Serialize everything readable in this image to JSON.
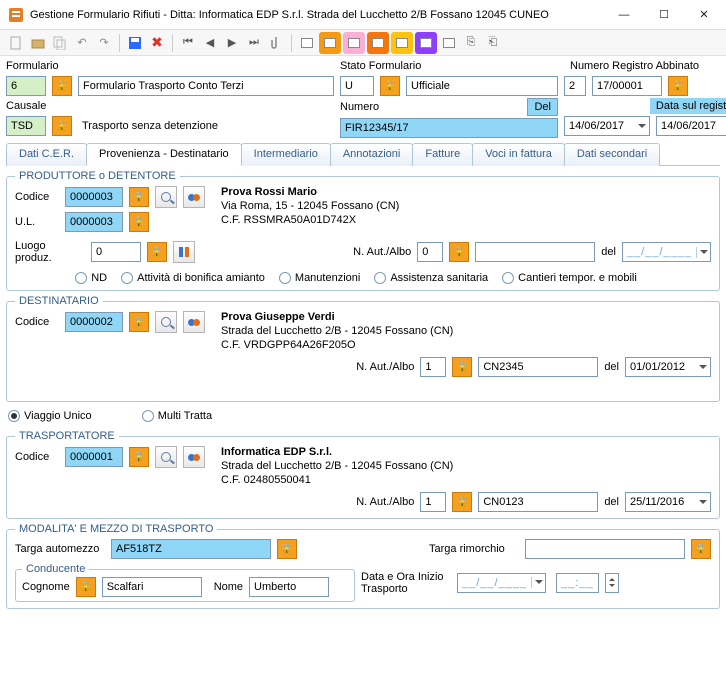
{
  "window": {
    "title": "Gestione Formulario Rifiuti - Ditta: Informatica EDP S.r.l. Strada del Lucchetto 2/B Fossano 12045 CUNEO"
  },
  "header": {
    "formulario_label": "Formulario",
    "formulario_num": "6",
    "formulario_tipo": "Formulario Trasporto Conto Terzi",
    "causale_label": "Causale",
    "causale_code": "TSD",
    "causale_desc": "Trasporto senza detenzione",
    "stato_label": "Stato Formulario",
    "stato_code": "U",
    "stato_desc": "Ufficiale",
    "numero_label": "Numero",
    "numero_val": "FIR12345/17",
    "del_label": "Del",
    "del_date": "14/06/2017",
    "reg_label": "Numero Registro Abbinato",
    "reg_num": "2",
    "reg_anno": "17/00001",
    "data_sul_registro_label": "Data sul registro",
    "data_sul_registro": "14/06/2017"
  },
  "tabs": [
    "Dati C.E.R.",
    "Provenienza - Destinatario",
    "Intermediario",
    "Annotazioni",
    "Fatture",
    "Voci in fattura",
    "Dati secondari"
  ],
  "produttore": {
    "legend": "PRODUTTORE o DETENTORE",
    "codice_label": "Codice",
    "codice": "0000003",
    "ul_label": "U.L.",
    "ul": "0000003",
    "name": "Prova Rossi Mario",
    "addr": "Via Roma, 15 - 12045 Fossano (CN)",
    "cf": "C.F. RSSMRA50A01D742X",
    "luogo_label": "Luogo produz.",
    "luogo": "0",
    "naut_label": "N. Aut./Albo",
    "naut_num": "0",
    "naut_text": "",
    "del": "del",
    "date_placeholder": "__/__/____",
    "radios": [
      "ND",
      "Attività di bonifica amianto",
      "Manutenzioni",
      "Assistenza sanitaria",
      "Cantieri tempor. e mobili"
    ]
  },
  "destinatario": {
    "legend": "DESTINATARIO",
    "codice_label": "Codice",
    "codice": "0000002",
    "name": "Prova Giuseppe Verdi",
    "addr": "Strada del Lucchetto 2/B - 12045 Fossano (CN)",
    "cf": "C.F. VRDGPP64A26F205O",
    "naut_label": "N. Aut./Albo",
    "naut_num": "1",
    "naut_text": "CN2345",
    "del": "del",
    "date": "01/01/2012"
  },
  "viaggio": {
    "unico": "Viaggio Unico",
    "multi": "Multi Tratta"
  },
  "trasportatore": {
    "legend": "TRASPORTATORE",
    "codice_label": "Codice",
    "codice": "0000001",
    "name": "Informatica EDP S.r.l.",
    "addr": "Strada del Lucchetto 2/B - 12045 Fossano (CN)",
    "cf": "C.F. 02480550041",
    "naut_label": "N. Aut./Albo",
    "naut_num": "1",
    "naut_text": "CN0123",
    "del": "del",
    "date": "25/11/2016"
  },
  "modalita": {
    "legend": "MODALITA' E MEZZO DI TRASPORTO",
    "targa_auto_label": "Targa automezzo",
    "targa_auto": "AF518TZ",
    "targa_rim_label": "Targa rimorchio",
    "targa_rim": "",
    "conducente_legend": "Conducente",
    "cognome_label": "Cognome",
    "cognome": "Scalfari",
    "nome_label": "Nome",
    "nome": "Umberto",
    "data_inizio_label": "Data e Ora Inizio Trasporto",
    "date_placeholder": "__/__/____",
    "time_placeholder": "__:__"
  }
}
